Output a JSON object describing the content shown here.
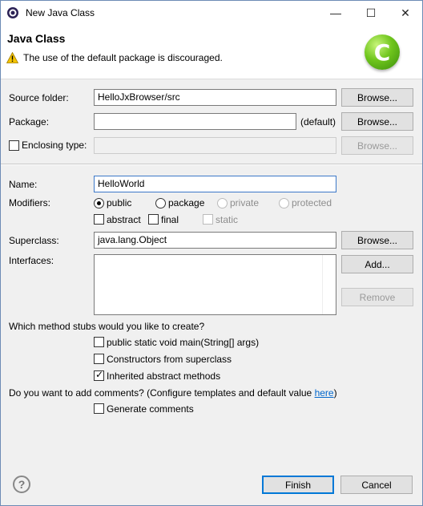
{
  "window": {
    "title": "New Java Class",
    "minimize_glyph": "—",
    "maximize_glyph": "☐",
    "close_glyph": "✕"
  },
  "header": {
    "title": "Java Class",
    "message": "The use of the default package is discouraged.",
    "logo_letter": "C"
  },
  "form": {
    "source_folder": {
      "label": "Source folder:",
      "value": "HelloJxBrowser/src",
      "browse": "Browse..."
    },
    "package": {
      "label": "Package:",
      "value": "",
      "hint": "(default)",
      "browse": "Browse..."
    },
    "enclosing_type": {
      "label": "Enclosing type:",
      "value": "",
      "browse": "Browse..."
    },
    "name": {
      "label": "Name:",
      "value": "HelloWorld"
    },
    "modifiers": {
      "label": "Modifiers:",
      "access": [
        "public",
        "package",
        "private",
        "protected"
      ],
      "selected": "public",
      "abstract": "abstract",
      "final": "final",
      "static": "static"
    },
    "superclass": {
      "label": "Superclass:",
      "value": "java.lang.Object",
      "browse": "Browse..."
    },
    "interfaces": {
      "label": "Interfaces:",
      "add": "Add...",
      "remove": "Remove"
    }
  },
  "stubs": {
    "question": "Which method stubs would you like to create?",
    "main": "public static void main(String[] args)",
    "constructors": "Constructors from superclass",
    "inherited": "Inherited abstract methods"
  },
  "comments": {
    "question": "Do you want to add comments? (Configure templates and default value ",
    "link": "here",
    "question_end": ")",
    "generate": "Generate comments"
  },
  "footer": {
    "help": "?",
    "finish": "Finish",
    "cancel": "Cancel"
  }
}
